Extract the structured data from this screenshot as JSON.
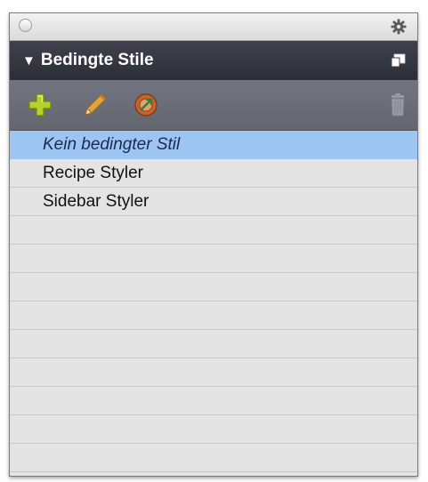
{
  "panel": {
    "header": {
      "title": "Bedingte Stile"
    },
    "toolbar": {
      "buttons": [
        {
          "icon": "plus-icon",
          "color": "#b5d12a"
        },
        {
          "icon": "pencil-icon",
          "color": "#e0a53a"
        },
        {
          "icon": "apply-style-icon",
          "color": "#c8632c"
        },
        {
          "icon": "trash-icon",
          "color": "#9a9ca3"
        }
      ]
    },
    "list": {
      "items": [
        {
          "label": "Kein bedingter Stil",
          "selected": true
        },
        {
          "label": "Recipe Styler",
          "selected": false
        },
        {
          "label": "Sidebar Styler",
          "selected": false
        }
      ],
      "selection_color": "#9ec4f2"
    }
  }
}
